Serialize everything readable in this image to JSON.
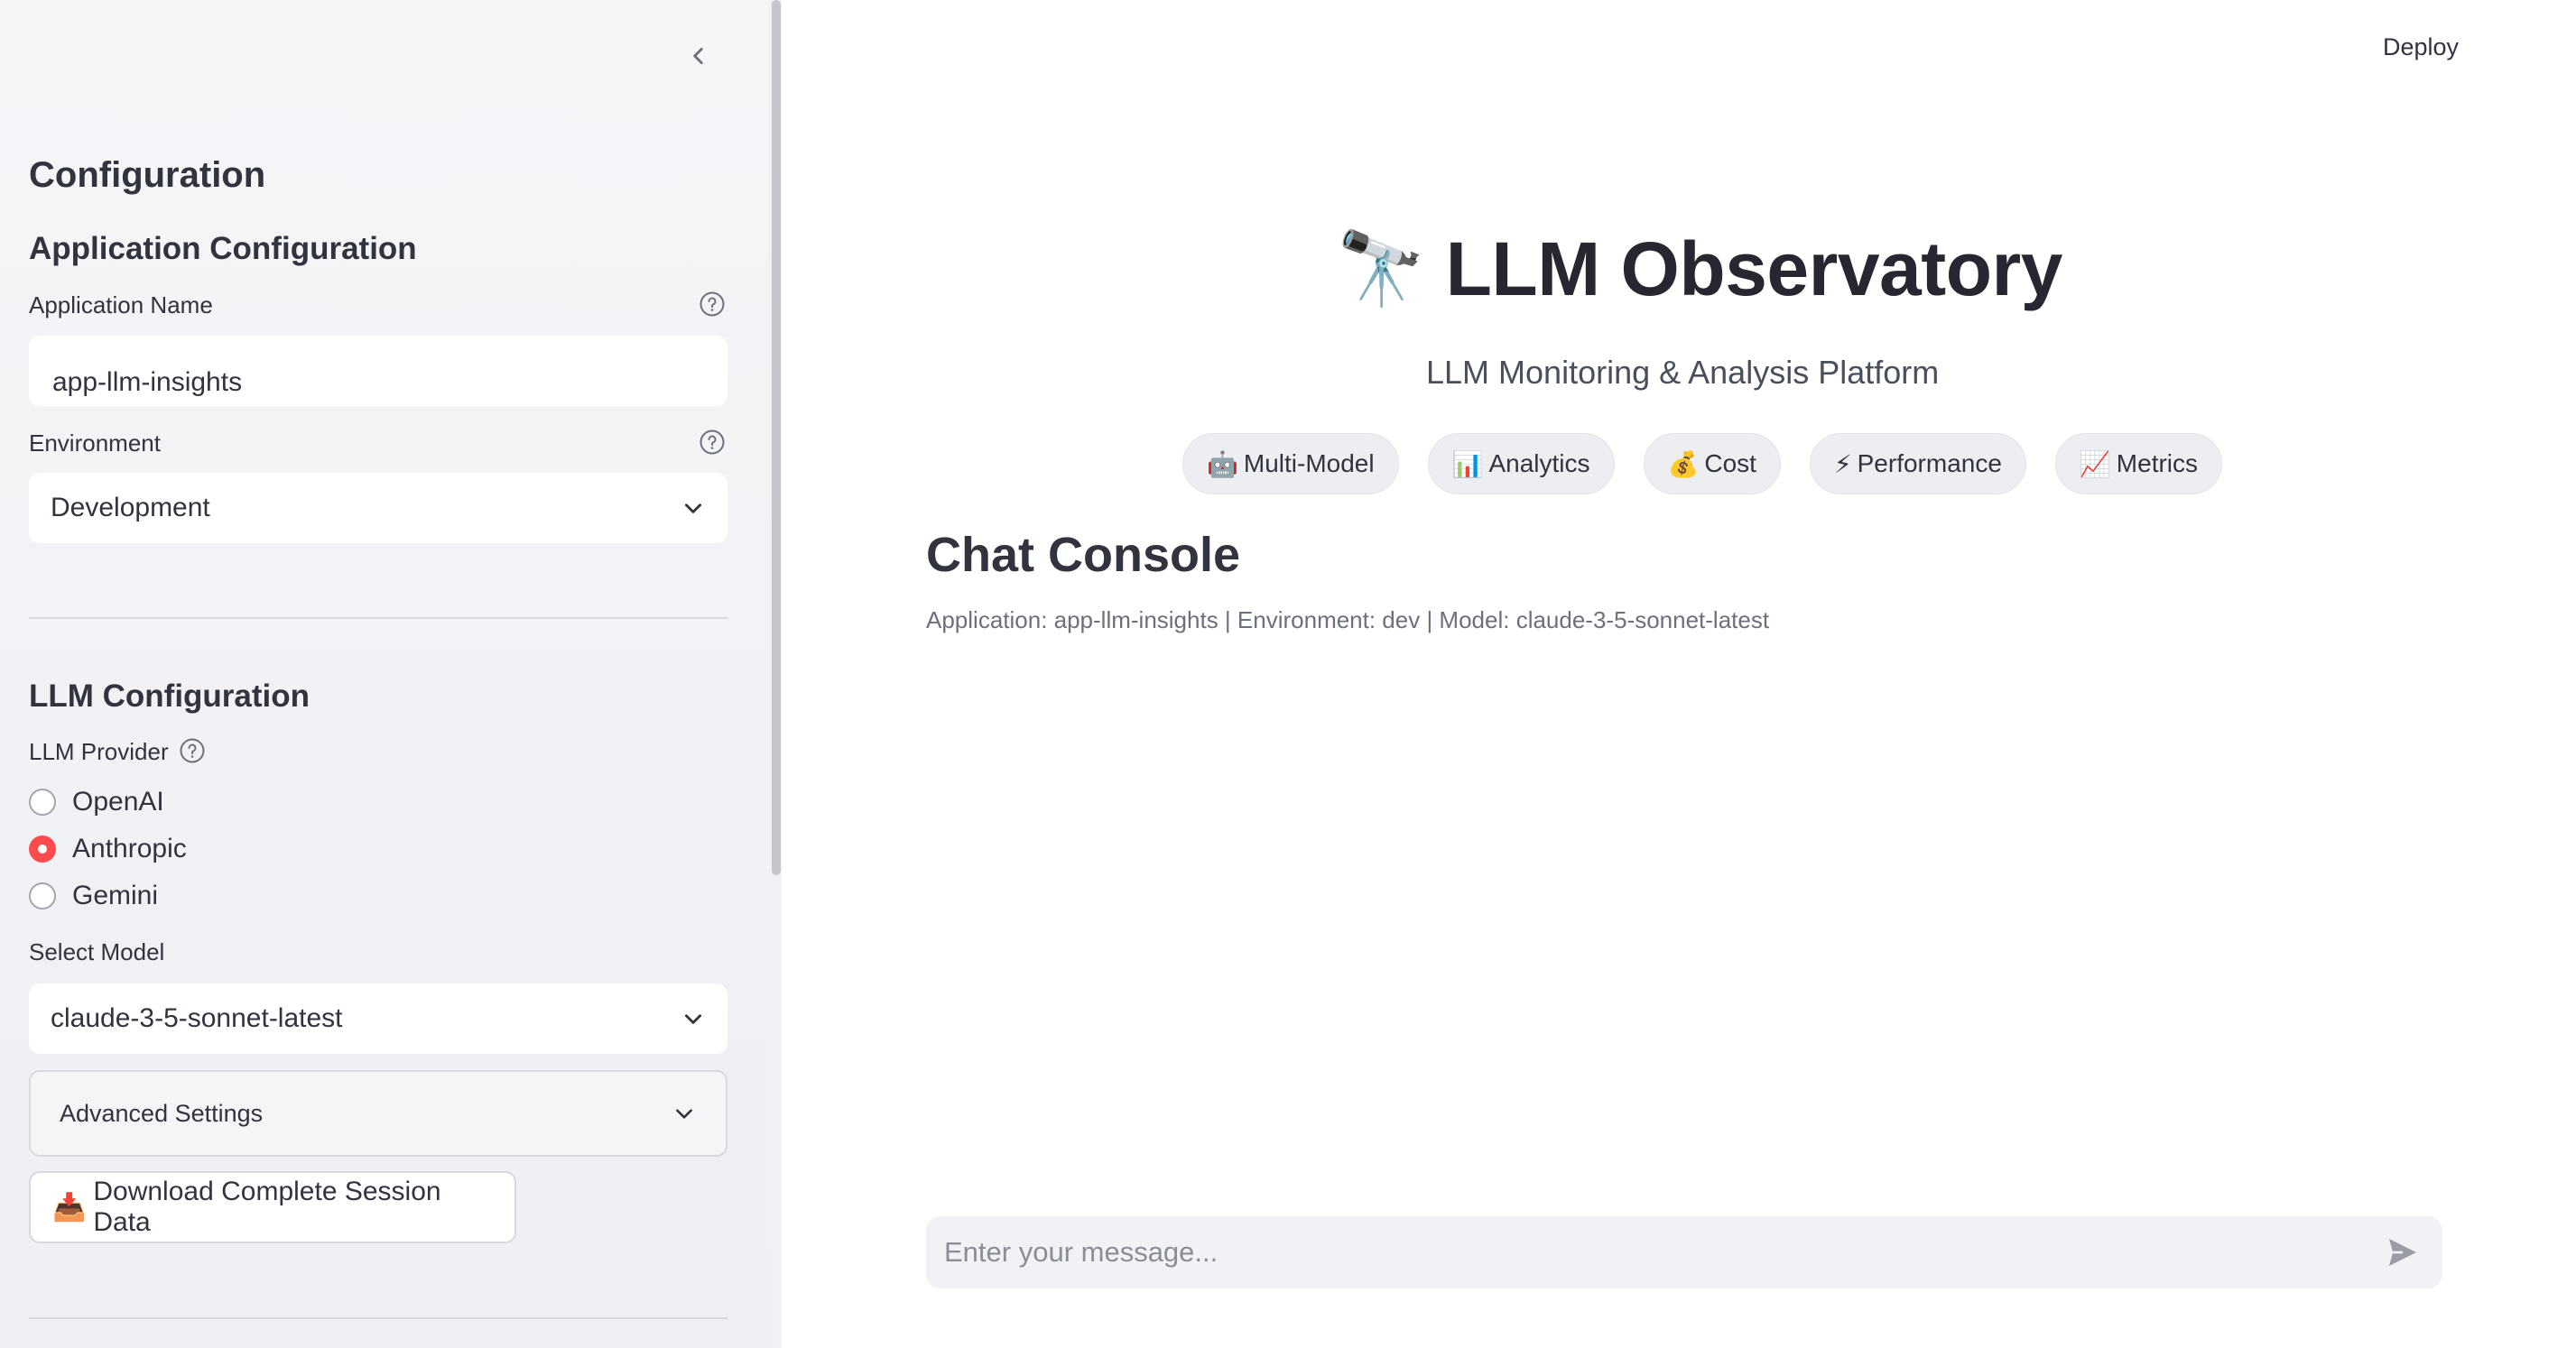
{
  "sidebar": {
    "title": "Configuration",
    "app_config": {
      "heading": "Application Configuration",
      "app_name_label": "Application Name",
      "app_name_value": "app-llm-insights",
      "environment_label": "Environment",
      "environment_value": "Development"
    },
    "llm_config": {
      "heading": "LLM Configuration",
      "provider_label": "LLM Provider",
      "providers": [
        {
          "label": "OpenAI",
          "selected": false
        },
        {
          "label": "Anthropic",
          "selected": true
        },
        {
          "label": "Gemini",
          "selected": false
        }
      ],
      "model_label": "Select Model",
      "model_value": "claude-3-5-sonnet-latest",
      "advanced_label": "Advanced Settings",
      "download_icon": "📥",
      "download_label": "Download Complete Session Data"
    }
  },
  "header": {
    "deploy_label": "Deploy"
  },
  "main": {
    "hero_emoji": "🔭",
    "title": "LLM Observatory",
    "tagline": "LLM Monitoring & Analysis Platform",
    "chips": [
      {
        "icon": "🤖",
        "label": "Multi-Model"
      },
      {
        "icon": "📊",
        "label": "Analytics"
      },
      {
        "icon": "💰",
        "label": "Cost"
      },
      {
        "icon": "⚡",
        "label": "Performance"
      },
      {
        "icon": "📈",
        "label": "Metrics"
      }
    ],
    "chat_title": "Chat Console",
    "chat_caption": "Application: app-llm-insights | Environment: dev | Model: claude-3-5-sonnet-latest",
    "input_placeholder": "Enter your message..."
  },
  "colors": {
    "accent": "#ff4b4b",
    "sidebar_bg": "#f0f2f6",
    "text": "#31333f",
    "muted": "#6c707b"
  }
}
